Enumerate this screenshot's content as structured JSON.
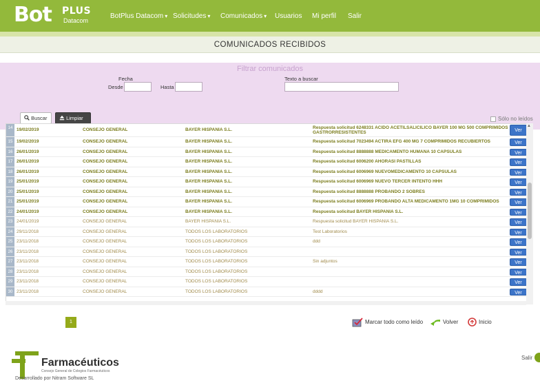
{
  "brand": {
    "logo_main": "Bot",
    "logo_plus": "PLUS",
    "logo_sub": "Datacom"
  },
  "nav": {
    "items": [
      {
        "label": "BotPlus Datacom",
        "dropdown": true
      },
      {
        "label": "Solicitudes",
        "dropdown": true
      },
      {
        "label": "Comunicados",
        "dropdown": true
      },
      {
        "label": "Usuarios",
        "dropdown": false
      },
      {
        "label": "Mi perfil",
        "dropdown": false
      },
      {
        "label": "Salir",
        "dropdown": false
      }
    ],
    "caret": "▾"
  },
  "page": {
    "title": "COMUNICADOS RECIBIDOS"
  },
  "filter": {
    "title": "Filtrar comunicados",
    "fecha_label": "Fecha",
    "desde_label": "Desde",
    "hasta_label": "Hasta",
    "desde_value": "",
    "hasta_value": "",
    "texto_label": "Texto a buscar",
    "texto_value": "",
    "buscar_label": "Buscar",
    "limpiar_label": "Limpiar",
    "unread_label": "Sólo no leídos",
    "unread_checked": false
  },
  "table": {
    "ver_label": "Ver",
    "rows": [
      {
        "n": "14",
        "date": "19/02/2019",
        "from": "CONSEJO GENERAL",
        "to": "BAYER HISPANIA S.L.",
        "subject": "Respuesta solicitud 6248331 ACIDO ACETILSALICILICO BAYER 100 MG 500 COMPRIMIDOS GASTRORRESISTENTES",
        "unread": true,
        "tall": true
      },
      {
        "n": "15",
        "date": "19/02/2019",
        "from": "CONSEJO GENERAL",
        "to": "BAYER HISPANIA S.L.",
        "subject": "Respuesta solicitud 7023494 ACTIRA EFG 400 MG 7 COMPRIMIDOS RECUBIERTOS",
        "unread": true
      },
      {
        "n": "16",
        "date": "26/01/2019",
        "from": "CONSEJO GENERAL",
        "to": "BAYER HISPANIA S.L.",
        "subject": "Respuesta solicitud 8888888 MEDICAMENTO HUMANA 10 CAPSULAS",
        "unread": true
      },
      {
        "n": "17",
        "date": "26/01/2019",
        "from": "CONSEJO GENERAL",
        "to": "BAYER HISPANIA S.L.",
        "subject": "Respuesta solicitud 6006200 AHORASI PASTILLAS",
        "unread": true
      },
      {
        "n": "18",
        "date": "26/01/2019",
        "from": "CONSEJO GENERAL",
        "to": "BAYER HISPANIA S.L.",
        "subject": "Respuesta solicitud 6006969 NUEVOMEDICAMENTO 10 CAPSULAS",
        "unread": true
      },
      {
        "n": "19",
        "date": "25/01/2019",
        "from": "CONSEJO GENERAL",
        "to": "BAYER HISPANIA S.L.",
        "subject": "Respuesta solicitud 6006969 NUEVO TERCER INTENTO HHH",
        "unread": true
      },
      {
        "n": "20",
        "date": "25/01/2019",
        "from": "CONSEJO GENERAL",
        "to": "BAYER HISPANIA S.L.",
        "subject": "Respuesta solicitud 8888888 PROBANDO 2 SOBRES",
        "unread": true
      },
      {
        "n": "21",
        "date": "25/01/2019",
        "from": "CONSEJO GENERAL",
        "to": "BAYER HISPANIA S.L.",
        "subject": "Respuesta solicitud 6006969 PROBANDO ALTA MEDICAMENTO 1MG 10 COMPRIMIDOS",
        "unread": true
      },
      {
        "n": "22",
        "date": "24/01/2019",
        "from": "CONSEJO GENERAL",
        "to": "BAYER HISPANIA S.L.",
        "subject": "Respuesta solicitud BAYER HISPANIA S.L.",
        "unread": true
      },
      {
        "n": "23",
        "date": "24/01/2019",
        "from": "CONSEJO GENERAL",
        "to": "BAYER HISPANIA S.L.",
        "subject": "Respuesta solicitud BAYER HISPANIA S.L.",
        "unread": false
      },
      {
        "n": "24",
        "date": "29/11/2018",
        "from": "CONSEJO GENERAL",
        "to": "TODOS LOS LABORATORIOS",
        "subject": "Test Laboratorios",
        "unread": false
      },
      {
        "n": "25",
        "date": "23/11/2018",
        "from": "CONSEJO GENERAL",
        "to": "TODOS LOS LABORATORIOS",
        "subject": "ddd",
        "unread": false
      },
      {
        "n": "26",
        "date": "23/11/2018",
        "from": "CONSEJO GENERAL",
        "to": "TODOS LOS LABORATORIOS",
        "subject": "",
        "unread": false
      },
      {
        "n": "27",
        "date": "23/11/2018",
        "from": "CONSEJO GENERAL",
        "to": "TODOS LOS LABORATORIOS",
        "subject": "Sin adjuntos",
        "unread": false
      },
      {
        "n": "28",
        "date": "23/11/2018",
        "from": "CONSEJO GENERAL",
        "to": "TODOS LOS LABORATORIOS",
        "subject": "",
        "unread": false
      },
      {
        "n": "29",
        "date": "23/11/2018",
        "from": "CONSEJO GENERAL",
        "to": "TODOS LOS LABORATORIOS",
        "subject": "",
        "unread": false
      },
      {
        "n": "30",
        "date": "23/11/2018",
        "from": "CONSEJO GENERAL",
        "to": "TODOS LOS LABORATORIOS",
        "subject": "dddd",
        "unread": false
      }
    ]
  },
  "pagination": {
    "current": "1"
  },
  "actions": {
    "mark_all": "Marcar todo como leído",
    "back": "Volver",
    "home": "Inicio"
  },
  "footer": {
    "brand": "Farmacéuticos",
    "sub": "Consejo General de Colegios Farmacéuticos",
    "dev": "Desarrollado por Nitram Software SL",
    "salir": "Salir"
  },
  "colors": {
    "topbar": "#93b93b",
    "filter_bg": "#eedaf0",
    "accent_blue": "#3c74c8",
    "pagination_green": "#95aa1a"
  }
}
